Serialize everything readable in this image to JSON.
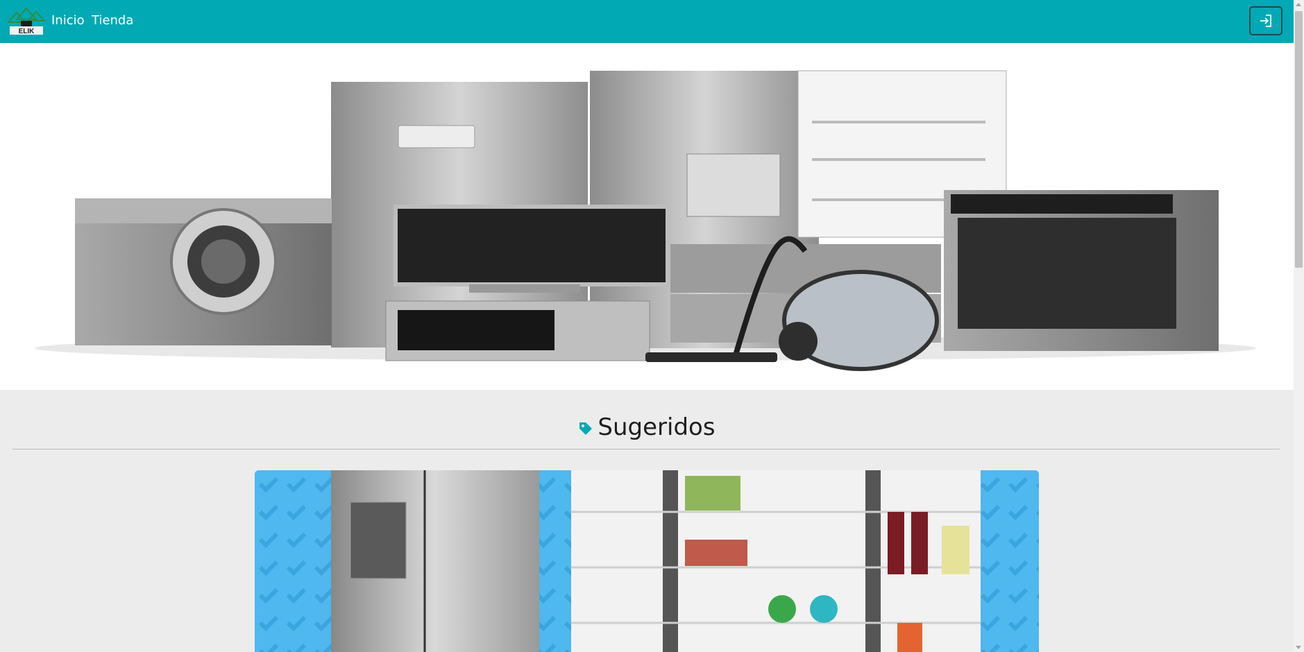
{
  "navbar": {
    "logo_text": "ELIK",
    "links": [
      {
        "label": "Inicio"
      },
      {
        "label": "Tienda"
      }
    ],
    "login_icon": "sign-in-icon",
    "background_color": "#00a9b4"
  },
  "hero": {
    "image": "appliances-collection"
  },
  "suggested": {
    "title": "Sugeridos",
    "icon": "tag-icon",
    "accent_color": "#00a9b4"
  },
  "banner": {
    "image": "side-by-side-refrigerator",
    "background_color": "#4fb8ef"
  }
}
